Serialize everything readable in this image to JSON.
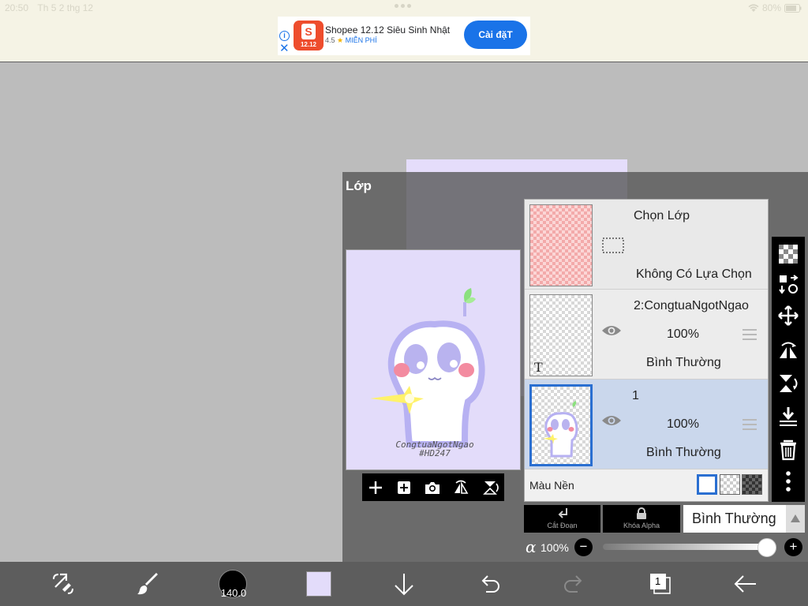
{
  "status_bar": {
    "time": "20:50",
    "date": "Th 5 2 thg 12",
    "battery": "80%"
  },
  "ad": {
    "title": "Shopee 12.12 Siêu Sinh Nhật",
    "rating": "4.5",
    "star": "★",
    "price": "MIỄN PHÍ",
    "install_label": "Cài đặT",
    "logo_letter": "S",
    "logo_date": "12.12",
    "info_glyph": "i",
    "close_glyph": "✕"
  },
  "panel": {
    "title": "Lớp",
    "layers": [
      {
        "name": "Chọn Lớp",
        "detail": "Không Có Lựa Chọn"
      },
      {
        "name": "2:CongtuaNgotNgao",
        "opacity": "100%",
        "blend": "Bình Thường",
        "type_glyph": "T"
      },
      {
        "name": "1",
        "opacity": "100%",
        "blend": "Bình Thường"
      }
    ],
    "background_label": "Màu Nền",
    "clipping_label": "Cắt Đoạn",
    "alpha_lock_label": "Khóa Alpha",
    "blend_mode": "Bình Thường",
    "alpha_symbol": "α",
    "opacity_value": "100%",
    "opacity_fraction": 1.0,
    "minus_glyph": "−",
    "plus_glyph": "+"
  },
  "preview": {
    "caption_line1": "CongtuaNgotNgao",
    "caption_line2": "#HD247"
  },
  "bottom_toolbar": {
    "brush_size": "140.0",
    "layer_count": "1"
  },
  "colors": {
    "accent": "#2a6fd1",
    "ad_button": "#1a73e8",
    "canvas_color": "#e3dcfa",
    "shopee": "#ee4d2d"
  }
}
